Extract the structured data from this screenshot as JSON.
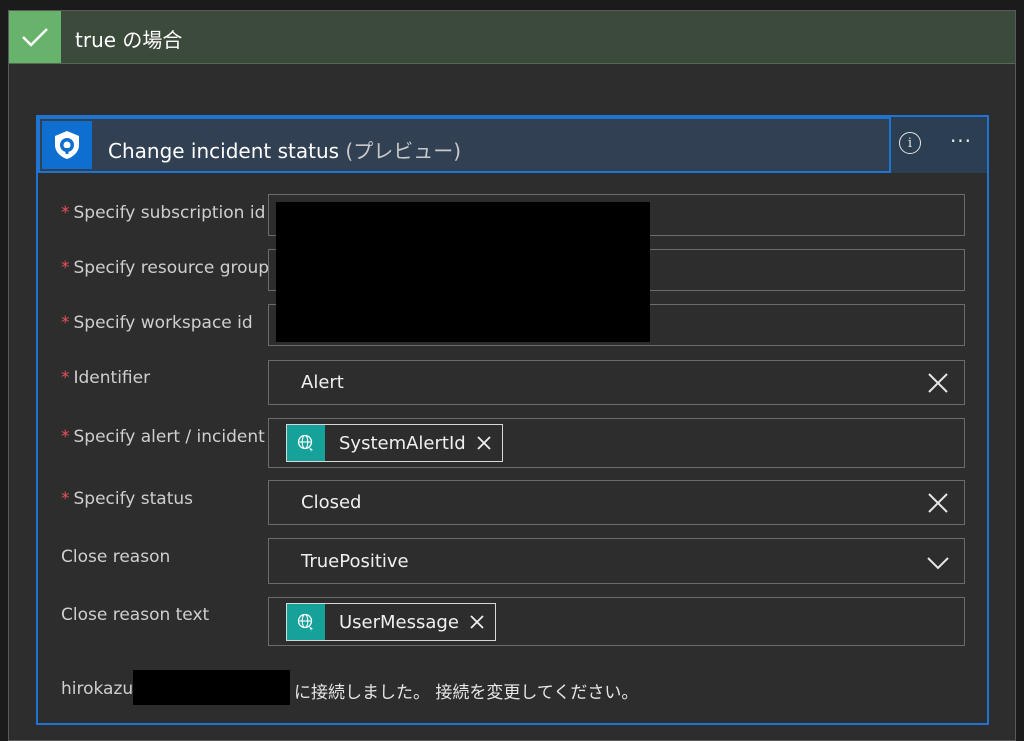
{
  "scope": {
    "title": "true の場合",
    "icon": "checkmark-icon"
  },
  "action": {
    "title": "Change incident status",
    "preview_tag": "(プレビュー)",
    "icon": "shield-icon",
    "info_icon": "i",
    "more_icon": "···"
  },
  "fields": [
    {
      "label": "Specify subscription id",
      "required": true,
      "value": ""
    },
    {
      "label": "Specify resource group",
      "required": true,
      "value": ""
    },
    {
      "label": "Specify workspace id",
      "required": true,
      "value": ""
    },
    {
      "label": "Identifier",
      "required": true,
      "value": "Alert",
      "control": "clearable"
    },
    {
      "label": "Specify alert / incident",
      "required": true,
      "token": "SystemAlertId"
    },
    {
      "label": "Specify status",
      "required": true,
      "value": "Closed",
      "control": "clearable"
    },
    {
      "label": "Close reason",
      "required": false,
      "value": "TruePositive",
      "control": "dropdown"
    },
    {
      "label": "Close reason text",
      "required": false,
      "token": "UserMessage"
    }
  ],
  "required_marker": "*",
  "footer": {
    "user_prefix": "hirokazu",
    "message": "に接続しました。 接続を変更してください。"
  },
  "colors": {
    "accent": "#1f73d1",
    "scope_check": "#68b36b",
    "token_icon": "#16a19a",
    "required": "#e8505b"
  }
}
